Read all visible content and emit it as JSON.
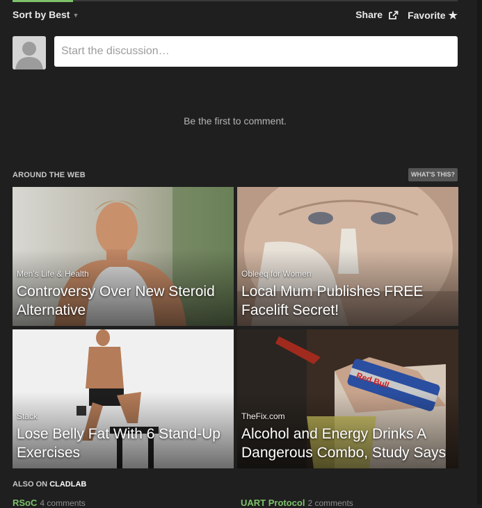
{
  "toolbar": {
    "sort_label": "Sort by Best",
    "share_label": "Share",
    "favorite_label": "Favorite"
  },
  "composer": {
    "placeholder": "Start the discussion…"
  },
  "empty_message": "Be the first to comment.",
  "around_the_web": {
    "title": "AROUND THE WEB",
    "whats_this": "WHAT'S THIS?",
    "cards": [
      {
        "source": "Men's Life & Health",
        "headline": "Controversy Over New Steroid Alternative"
      },
      {
        "source": "Obleeq for Women",
        "headline": "Local Mum Publishes FREE Facelift Secret!"
      },
      {
        "source": "Stack",
        "headline": "Lose Belly Fat With 6 Stand-Up Exercises"
      },
      {
        "source": "TheFix.com",
        "headline": "Alcohol and Energy Drinks A Dangerous Combo, Study Says"
      }
    ]
  },
  "also_on": {
    "prefix": "ALSO ON",
    "site": "CLADLAB",
    "items": [
      {
        "title": "RSoC",
        "comments": "4 comments"
      },
      {
        "title": "UART Protocol",
        "comments": "2 comments"
      }
    ]
  },
  "colors": {
    "accent": "#7ec26a",
    "background": "#1f1f1f"
  }
}
